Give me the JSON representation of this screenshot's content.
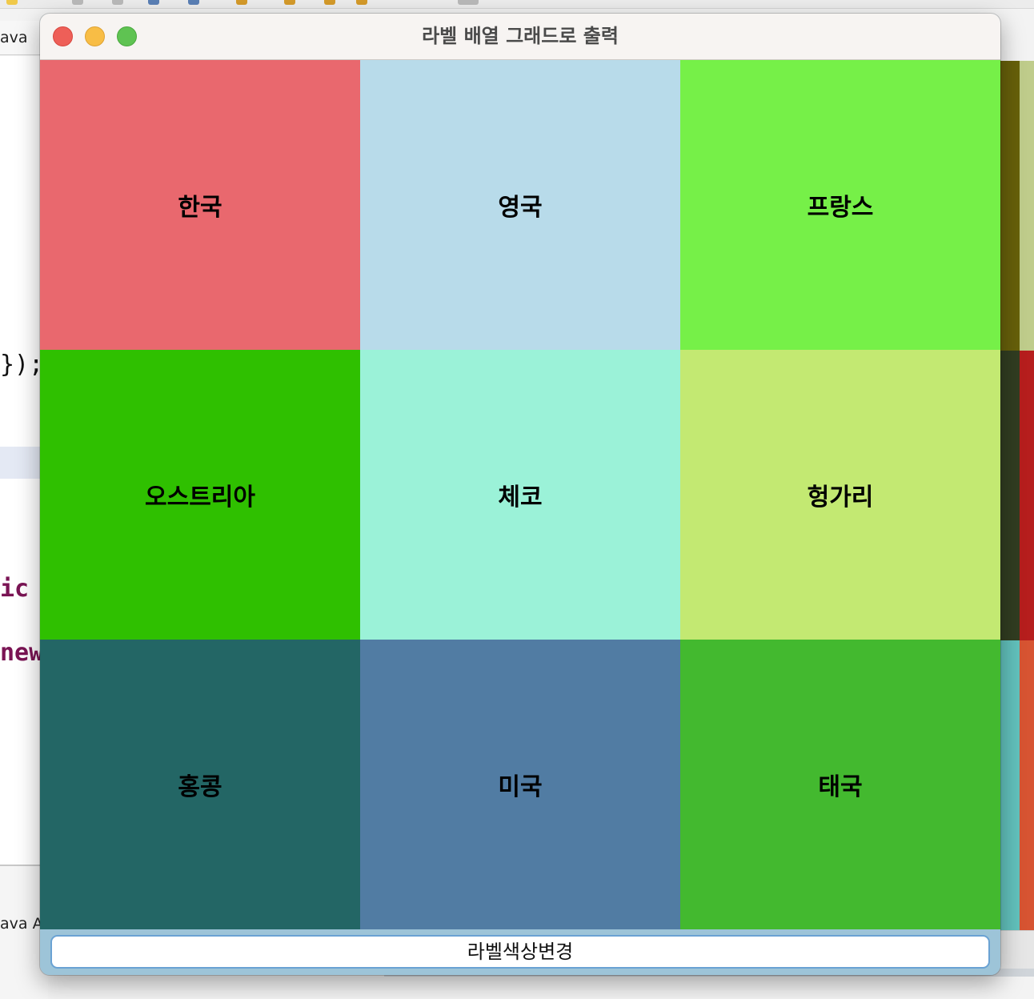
{
  "window": {
    "title": "라벨 배열 그래드로 출력"
  },
  "grid": {
    "cells": [
      {
        "label": "한국",
        "color": "#e9686e"
      },
      {
        "label": "영국",
        "color": "#b8dbea"
      },
      {
        "label": "프랑스",
        "color": "#76f048"
      },
      {
        "label": "오스트리아",
        "color": "#2fc000"
      },
      {
        "label": "체코",
        "color": "#9bf2d8"
      },
      {
        "label": "헝가리",
        "color": "#c3e972"
      },
      {
        "label": "홍콩",
        "color": "#236665"
      },
      {
        "label": "미국",
        "color": "#517ca3"
      },
      {
        "label": "태국",
        "color": "#43b92f"
      }
    ]
  },
  "bottom_bar": {
    "button_label": "라벨색상변경",
    "background": "#9dc4d8"
  },
  "background_ide": {
    "tab_label": "ava",
    "code_brace": "});",
    "code_keyword_ic": "ic",
    "code_keyword_new": "new",
    "bottom_panel_label": "ava A"
  },
  "back_window": {
    "strip_colors": [
      [
        "#67600a",
        "#bfcc8b"
      ],
      [
        "#313d21",
        "#b61e1d"
      ],
      [
        "#62c2bd",
        "#d75432"
      ]
    ]
  }
}
